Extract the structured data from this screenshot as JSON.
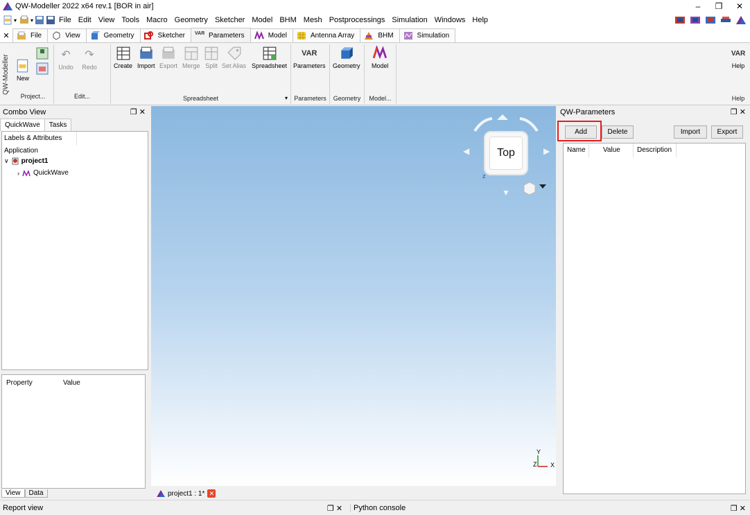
{
  "window": {
    "title": "QW-Modeller 2022 x64 rev.1 [BOR in air]",
    "controls": [
      "–",
      "❐",
      "✕"
    ]
  },
  "menu": [
    "File",
    "Edit",
    "View",
    "Tools",
    "Macro",
    "Geometry",
    "Sketcher",
    "Model",
    "BHM",
    "Mesh",
    "Postprocessings",
    "Simulation",
    "Windows",
    "Help"
  ],
  "ribbon_tabs": [
    "File",
    "View",
    "Geometry",
    "Sketcher",
    "Parameters",
    "Model",
    "Antenna Array",
    "BHM",
    "Simulation"
  ],
  "active_ribbon_tab": "Parameters",
  "ribbon": {
    "side_label": "QW-Modeller",
    "project": {
      "new": "New",
      "group": "Project..."
    },
    "edit": {
      "undo": "Undo",
      "redo": "Redo",
      "group": "Edit..."
    },
    "spreadsheet": {
      "buttons": [
        "Create",
        "Import",
        "Export",
        "Merge",
        "Split",
        "Set Alias",
        "Spreadsheet"
      ],
      "group": "Spreadsheet"
    },
    "parameters": {
      "button": "Parameters",
      "group": "Parameters",
      "var_text": "VAR"
    },
    "geometry": {
      "button": "Geometry",
      "group": "Geometry"
    },
    "model": {
      "button": "Model",
      "group": "Model..."
    },
    "help": {
      "button": "Help",
      "group": "Help"
    }
  },
  "combo_view": {
    "title": "Combo View",
    "tabs": [
      "QuickWave",
      "Tasks"
    ],
    "tree_header": "Labels & Attributes",
    "application": "Application",
    "project": "project1",
    "child": "QuickWave",
    "props_headers": [
      "Property",
      "Value"
    ],
    "bottom_tabs": [
      "View",
      "Data"
    ]
  },
  "viewport": {
    "navcube_face": "Top",
    "navcube_axis": "z",
    "axes": {
      "y": "Y",
      "z": "Z",
      "x": "X"
    },
    "doc_tab": "project1 : 1*"
  },
  "qw_parameters": {
    "title": "QW-Parameters",
    "buttons": {
      "add": "Add",
      "delete": "Delete",
      "import": "Import",
      "export": "Export"
    },
    "columns": [
      "Name",
      "Value",
      "Description"
    ],
    "highlight_color": "#e41e1e"
  },
  "bottom": {
    "report_view": "Report view",
    "python_console": "Python console"
  }
}
